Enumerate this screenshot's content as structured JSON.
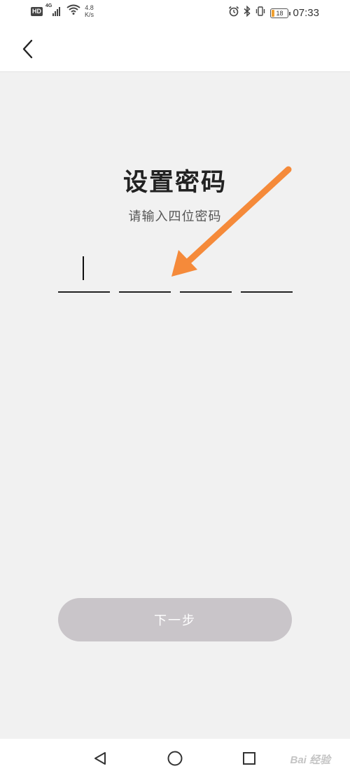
{
  "status_bar": {
    "hd_badge": "HD",
    "network": "4G",
    "speed_value": "4.8",
    "speed_unit": "K/s",
    "battery": "18",
    "battery_fraction": 0.18,
    "time": "07:33",
    "icons": [
      "signal-icon",
      "wifi-icon",
      "alarm-icon",
      "bluetooth-icon",
      "vibrate-icon",
      "battery-icon"
    ]
  },
  "header": {
    "back_icon": "chevron-left-icon"
  },
  "main": {
    "title": "设置密码",
    "subtitle": "请输入四位密码",
    "pin_slots": 4,
    "focused_slot": 1,
    "next_label": "下一步"
  },
  "annotation": {
    "arrow_color": "#f58a3a"
  },
  "nav_bar": {
    "icons": [
      "back-triangle-icon",
      "home-circle-icon",
      "recents-square-icon"
    ]
  },
  "watermark": "Bai 经验",
  "colors": {
    "background": "#f1f1f1",
    "button_disabled": "#c9c5c9",
    "arrow": "#f58a3a"
  }
}
